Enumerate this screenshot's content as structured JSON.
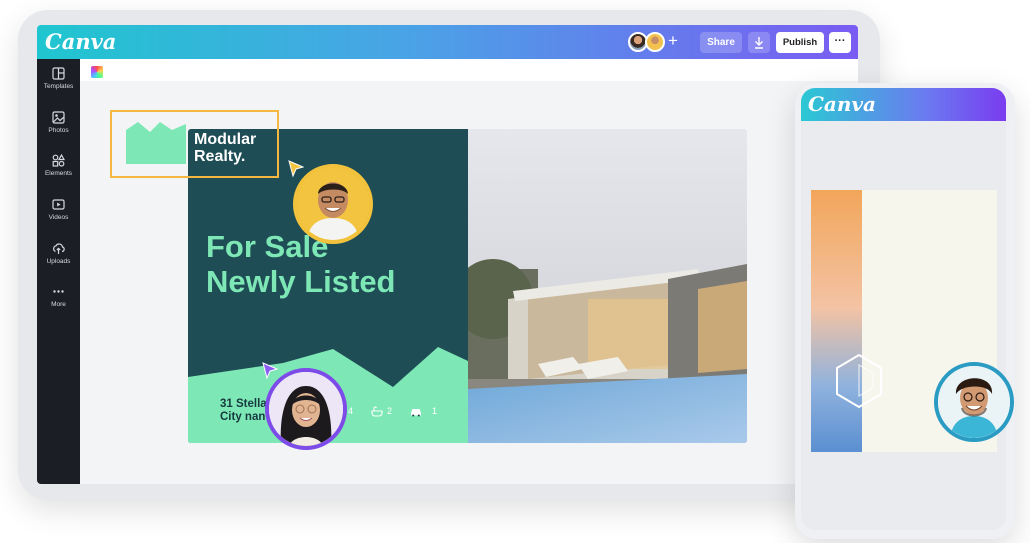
{
  "app": {
    "logo": "Canva"
  },
  "topbar": {
    "share_label": "Share",
    "publish_label": "Publish",
    "more_label": "···",
    "add_label": "+"
  },
  "sidebar": {
    "items": [
      {
        "label": "Templates",
        "icon": "templates-icon"
      },
      {
        "label": "Photos",
        "icon": "photos-icon"
      },
      {
        "label": "Elements",
        "icon": "elements-icon"
      },
      {
        "label": "Videos",
        "icon": "videos-icon"
      },
      {
        "label": "Uploads",
        "icon": "uploads-icon"
      },
      {
        "label": "More",
        "icon": "more-icon"
      }
    ]
  },
  "design": {
    "brand": {
      "line1": "Modular",
      "line2": "Realty."
    },
    "headline": {
      "line1": "For Sale",
      "line2": "Newly Listed"
    },
    "address": {
      "line1": "31 Stella",
      "line2": "City nan"
    },
    "features": {
      "beds": "4",
      "baths": "2",
      "cars": "1"
    }
  },
  "phone": {
    "logo": "Canva"
  },
  "colors": {
    "topbar_gradient": [
      "#1fc6cf",
      "#7a5cf2"
    ],
    "design_dark": "#1f4d55",
    "design_mint": "#7ee7b6",
    "selection": "#f4b740",
    "sidebar": "#1b1e25"
  }
}
